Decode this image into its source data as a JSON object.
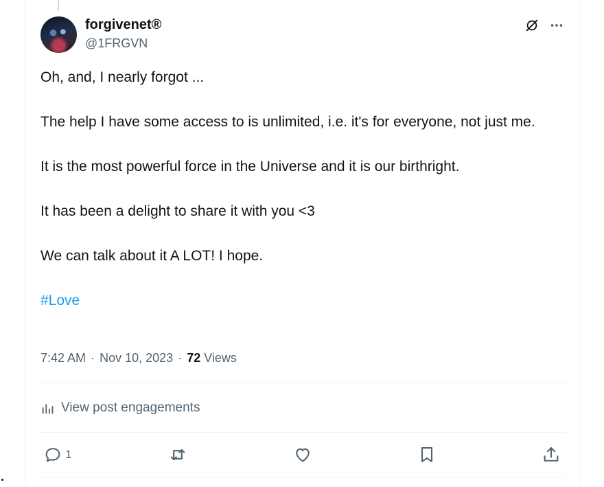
{
  "author": {
    "display_name": "forgivenet®",
    "handle": "@1FRGVN"
  },
  "header_icons": [
    "grok-icon",
    "more-options-icon"
  ],
  "post": {
    "paragraphs": [
      "Oh, and, I nearly forgot ...",
      "The help I have some access to is unlimited, i.e. it's for everyone, not just me.",
      "It is the most powerful force in the Universe and it is our birthright.",
      "It has been a delight to share it with you <3",
      "We can talk about it A LOT! I hope."
    ],
    "hashtag": "#Love"
  },
  "meta": {
    "time": "7:42 AM",
    "separator": "·",
    "date": "Nov 10, 2023",
    "views_count": "72",
    "views_label": "Views"
  },
  "engagements": {
    "label": "View post engagements",
    "icon": "analytics-bars-icon"
  },
  "actions": {
    "reply_count": "1",
    "icons": [
      "reply-icon",
      "repost-icon",
      "like-icon",
      "bookmark-icon",
      "share-icon"
    ]
  },
  "colors": {
    "link": "#1d9bf0",
    "secondary_text": "#536471",
    "primary_text": "#0f1419",
    "divider": "#eff3f4"
  }
}
